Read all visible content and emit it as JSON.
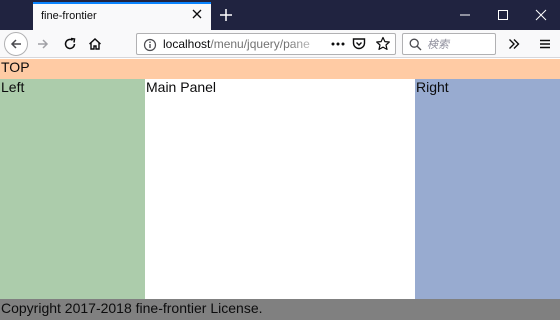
{
  "browser": {
    "tab_title": "fine-frontier",
    "url_host": "localhost",
    "url_path": "/menu/jquery/pane",
    "search_placeholder": "検索",
    "colors": {
      "titlebar": "#202340",
      "toolbar": "#f9f9fa",
      "tab_accent": "#0a84ff"
    },
    "icons": [
      "close-icon",
      "plus-icon",
      "minimize-icon",
      "maximize-icon",
      "window-close-icon",
      "back-arrow-icon",
      "forward-arrow-icon",
      "reload-icon",
      "home-icon",
      "info-icon",
      "more-dots-icon",
      "pocket-icon",
      "star-icon",
      "search-icon",
      "chevron-double-right-icon",
      "hamburger-menu-icon"
    ]
  },
  "page": {
    "top_label": "TOP",
    "left_label": "Left",
    "main_label": "Main Panel",
    "right_label": "Right",
    "footer_text": "Copyright 2017-2018 fine-frontier License.",
    "colors": {
      "top": "#ffcba4",
      "left": "#acccab",
      "main": "#ffffff",
      "right": "#98abd0",
      "footer": "#808080"
    }
  }
}
